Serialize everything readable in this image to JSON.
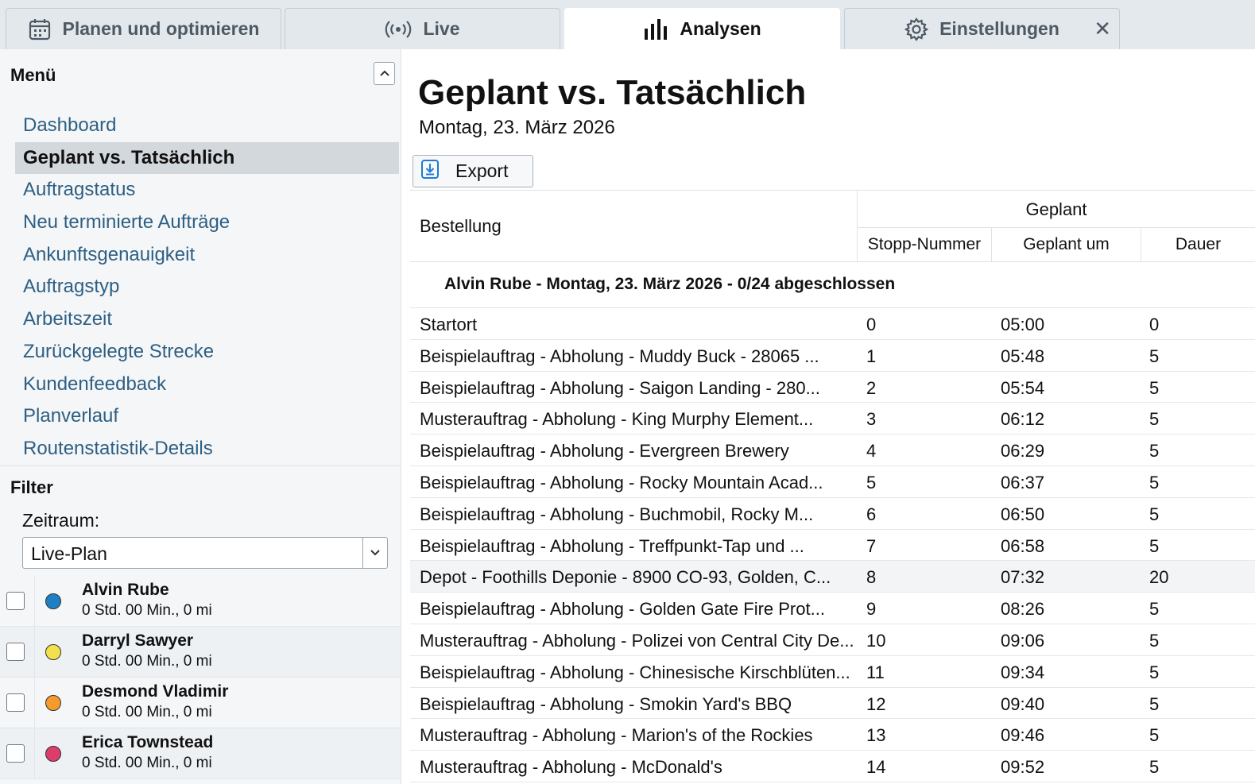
{
  "tabs": [
    {
      "label": "Planen und optimieren",
      "icon": "calendar-icon"
    },
    {
      "label": "Live",
      "icon": "broadcast-icon"
    },
    {
      "label": "Analysen",
      "icon": "bar-chart-icon"
    },
    {
      "label": "Einstellungen",
      "icon": "gear-icon"
    }
  ],
  "tab_close_icon": "close-icon",
  "sidebar": {
    "menu_title": "Menü",
    "menu_items": [
      "Dashboard",
      "Geplant vs. Tatsächlich",
      "Auftragstatus",
      "Neu terminierte Aufträge",
      "Ankunftsgenauigkeit",
      "Auftragstyp",
      "Arbeitszeit",
      "Zurückgelegte Strecke",
      "Kundenfeedback",
      "Planverlauf",
      "Routenstatistik-Details"
    ],
    "active_menu_item": "Geplant vs. Tatsächlich",
    "filter_title": "Filter",
    "zeitraum_label": "Zeitraum:",
    "zeitraum_value": "Live-Plan",
    "drivers": [
      {
        "name": "Alvin Rube",
        "summary": "0 Std. 00 Min., 0 mi",
        "color": "#1f7fc4"
      },
      {
        "name": "Darryl Sawyer",
        "summary": "0 Std. 00 Min., 0 mi",
        "color": "#f2e14c"
      },
      {
        "name": "Desmond Vladimir",
        "summary": "0 Std. 00 Min., 0 mi",
        "color": "#f59a2c"
      },
      {
        "name": "Erica Townstead",
        "summary": "0 Std. 00 Min., 0 mi",
        "color": "#dc3d6a"
      }
    ]
  },
  "main": {
    "title": "Geplant vs. Tatsächlich",
    "date": "Montag, 23. März 2026",
    "export_label": "Export",
    "table": {
      "order_header": "Bestellung",
      "group_header": "Geplant",
      "sub_headers": [
        "Stopp-Nummer",
        "Geplant um",
        "Dauer"
      ],
      "group_label": "Alvin Rube - Montag, 23. März 2026 - 0/24 abgeschlossen",
      "rows": [
        {
          "order": "Startort",
          "stop": "0",
          "time": "05:00",
          "duration": "0"
        },
        {
          "order": "Beispielauftrag - Abholung - Muddy Buck - 28065 ...",
          "stop": "1",
          "time": "05:48",
          "duration": "5"
        },
        {
          "order": "Beispielauftrag - Abholung - Saigon Landing - 280...",
          "stop": "2",
          "time": "05:54",
          "duration": "5"
        },
        {
          "order": "Musterauftrag - Abholung - King Murphy Element...",
          "stop": "3",
          "time": "06:12",
          "duration": "5"
        },
        {
          "order": "Beispielauftrag - Abholung - Evergreen Brewery",
          "stop": "4",
          "time": "06:29",
          "duration": "5"
        },
        {
          "order": "Beispielauftrag - Abholung - Rocky Mountain Acad...",
          "stop": "5",
          "time": "06:37",
          "duration": "5"
        },
        {
          "order": "Beispielauftrag - Abholung - Buchmobil, Rocky M...",
          "stop": "6",
          "time": "06:50",
          "duration": "5"
        },
        {
          "order": "Beispielauftrag - Abholung - Treffpunkt-Tap und ...",
          "stop": "7",
          "time": "06:58",
          "duration": "5"
        },
        {
          "order": "Depot - Foothills Deponie - 8900 CO-93, Golden, C...",
          "stop": "8",
          "time": "07:32",
          "duration": "20"
        },
        {
          "order": "Beispielauftrag - Abholung - Golden Gate Fire Prot...",
          "stop": "9",
          "time": "08:26",
          "duration": "5"
        },
        {
          "order": "Musterauftrag - Abholung - Polizei von Central City De...",
          "stop": "10",
          "time": "09:06",
          "duration": "5"
        },
        {
          "order": "Beispielauftrag - Abholung - Chinesische Kirschblüten...",
          "stop": "11",
          "time": "09:34",
          "duration": "5"
        },
        {
          "order": "Beispielauftrag - Abholung - Smokin Yard's BBQ",
          "stop": "12",
          "time": "09:40",
          "duration": "5"
        },
        {
          "order": "Musterauftrag - Abholung - Marion's of the Rockies",
          "stop": "13",
          "time": "09:46",
          "duration": "5"
        },
        {
          "order": "Musterauftrag - Abholung - McDonald's",
          "stop": "14",
          "time": "09:52",
          "duration": "5"
        }
      ]
    }
  }
}
